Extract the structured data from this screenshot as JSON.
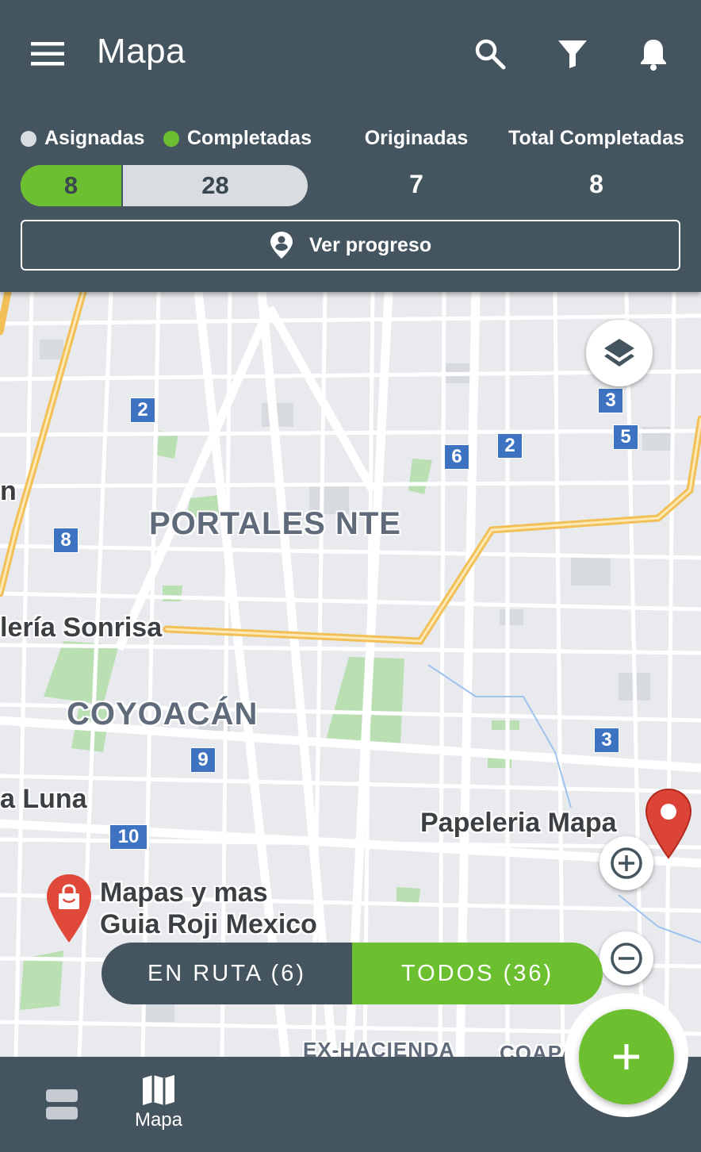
{
  "header": {
    "title": "Mapa",
    "menu_icon": "menu-icon",
    "search_icon": "search-icon",
    "filter_icon": "filter-icon",
    "bell_icon": "bell-icon"
  },
  "legend": {
    "assigned": {
      "label": "Asignadas",
      "color": "#d9dde1"
    },
    "completed": {
      "label": "Completadas",
      "color": "#6cbf2f"
    }
  },
  "progress": {
    "completed_value": "8",
    "assigned_value": "28",
    "completed_fraction": 0.2857
  },
  "stats": {
    "originated_label": "Originadas",
    "originated_value": "7",
    "total_completed_label": "Total Completadas",
    "total_completed_value": "8"
  },
  "progress_button": {
    "label": "Ver progreso",
    "icon": "location-person-icon"
  },
  "map": {
    "districts": [
      "PORTALES NTE",
      "COYOACÁN",
      "EX-HACIENDA",
      "COAPA"
    ],
    "place_labels": [
      "n",
      "lería Sonrisa",
      "a Luna",
      "Papeleria Mapa",
      "Mapas y mas",
      "Guia Roji Mexico"
    ],
    "markers": [
      "2",
      "3",
      "6",
      "2",
      "5",
      "8",
      "3",
      "9",
      "10"
    ],
    "layers_icon": "layers-icon",
    "zoom_in_icon": "zoom-in-icon",
    "zoom_out_icon": "zoom-out-icon"
  },
  "toggle": {
    "en_ruta": "EN RUTA (6)",
    "todos": "TODOS (36)",
    "selected": "todos"
  },
  "bottom_nav": {
    "list_icon": "list-icon",
    "map_label": "Mapa",
    "map_icon": "map-icon",
    "fab_icon": "plus-icon"
  },
  "colors": {
    "primary": "#455560",
    "accent": "#6cbf2f",
    "marker_blue": "#3d73c1",
    "pin_red": "#db4437"
  }
}
